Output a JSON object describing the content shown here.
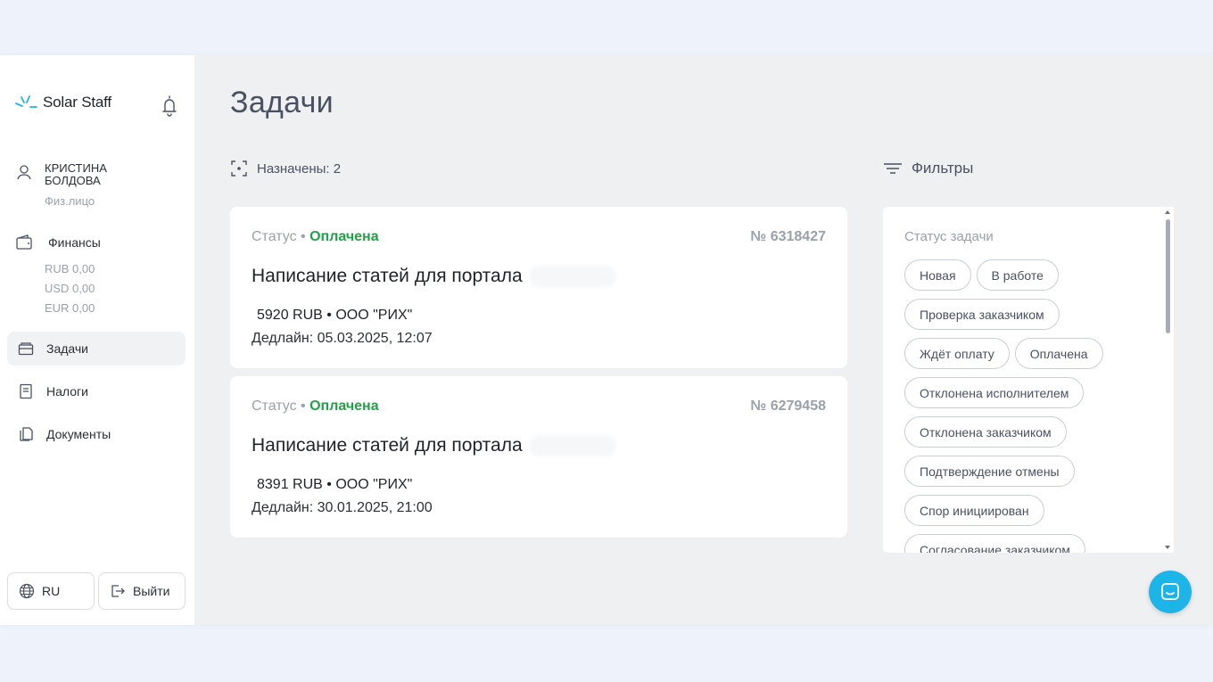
{
  "brand": {
    "name": "Solar Staff",
    "accent": "#1fb4e8"
  },
  "user": {
    "name": "КРИСТИНА БОЛДОВА",
    "type": "Физ.лицо"
  },
  "finance": {
    "label": "Финансы",
    "rub": "RUB 0,00",
    "usd": "USD 0,00",
    "eur": "EUR 0,00"
  },
  "nav": {
    "tasks": "Задачи",
    "taxes": "Налоги",
    "documents": "Документы"
  },
  "bottom": {
    "lang": "RU",
    "logout": "Выйти"
  },
  "page": {
    "title": "Задачи",
    "assigned": "Назначены: 2",
    "filters": "Фильтры"
  },
  "cards": [
    {
      "status_label": "Статус",
      "status_value": "Оплачена",
      "number": "№ 6318427",
      "title": "Написание статей для портала",
      "price": "5920 RUB • ООО \"РИХ\"",
      "deadline": "Дедлайн: 05.03.2025, 12:07"
    },
    {
      "status_label": "Статус",
      "status_value": "Оплачена",
      "number": "№ 6279458",
      "title": "Написание статей для портала",
      "price": "8391 RUB • ООО \"РИХ\"",
      "deadline": "Дедлайн: 30.01.2025, 21:00"
    }
  ],
  "filter_panel": {
    "title": "Статус задачи",
    "chips": [
      "Новая",
      "В работе",
      "Проверка заказчиком",
      "Ждёт оплату",
      "Оплачена",
      "Отклонена исполнителем",
      "Отклонена заказчиком",
      "Подтверждение отмены",
      "Спор инициирован",
      "Согласование заказчиком"
    ]
  },
  "colors": {
    "status_paid": "#24a148",
    "chat_button": "#1fb4e8"
  }
}
